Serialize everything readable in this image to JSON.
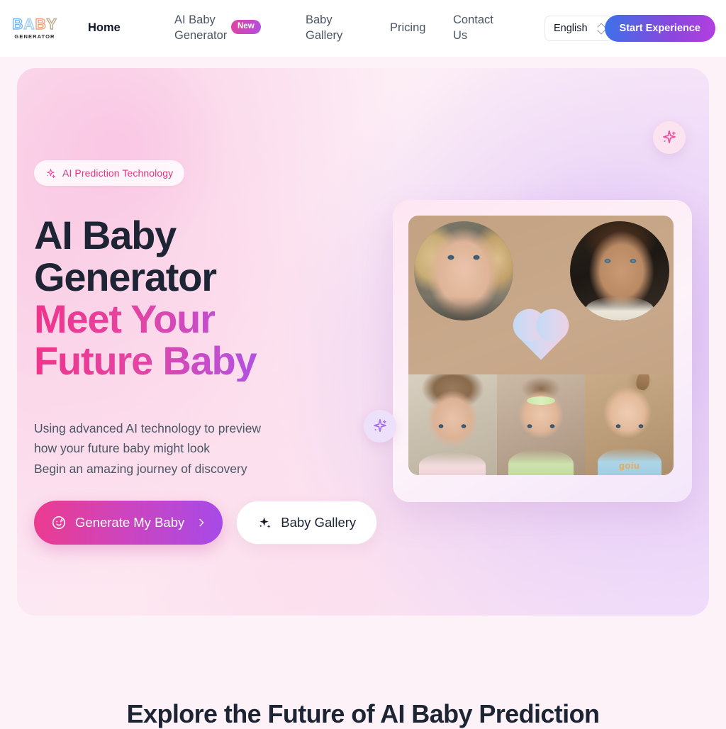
{
  "nav": {
    "logo": {
      "main": "BABY",
      "sub": "GENERATOR",
      "letters": [
        "B",
        "A",
        "B",
        "Y"
      ]
    },
    "links": [
      {
        "label": "Home",
        "active": true
      },
      {
        "label": "AI Baby Generator",
        "badge": "New"
      },
      {
        "label": "Baby Gallery"
      },
      {
        "label": "Pricing"
      },
      {
        "label": "Contact Us"
      }
    ],
    "new_badge": "New",
    "language": {
      "value": "English",
      "icon": "chevron-up-down-icon"
    },
    "cta": "Start Experience"
  },
  "hero": {
    "badge": {
      "icon": "sparkles-icon",
      "text": "AI Prediction Technology"
    },
    "title_line1": "AI Baby",
    "title_line2": "Generator",
    "title_gradient_line1": "Meet Your",
    "title_gradient_line2": "Future Baby",
    "subtitle_line1": "Using advanced AI technology to preview",
    "subtitle_line2": "how your future baby might look",
    "subtitle_line3": "Begin an amazing journey of discovery",
    "primary_cta": {
      "label": "Generate My Baby",
      "icon": "baby-face-icon",
      "arrow": "chevron-right-icon"
    },
    "secondary_cta": {
      "label": "Baby Gallery",
      "icon": "sparkles-icon"
    },
    "visual": {
      "parents": [
        "mother-portrait",
        "father-portrait"
      ],
      "heart": "heart-shape",
      "babies": [
        "baby-photo-1",
        "baby-photo-2",
        "baby-photo-3"
      ],
      "baby3_shirt_text": "goiu"
    },
    "float_badges": [
      {
        "icon": "sparkle-star-icon",
        "position": "top-right",
        "color": "#fbe3f0"
      },
      {
        "icon": "sparkle-star-icon",
        "position": "bottom-left",
        "color": "#ece0fb"
      }
    ]
  },
  "section": {
    "title": "Explore the Future of AI Baby Prediction"
  },
  "colors": {
    "accent_pink": "#e0357f",
    "accent_purple": "#a74ae8",
    "dark_text": "#1d2433",
    "body_text": "#4b5563",
    "page_bg": "#fdf2f8"
  }
}
